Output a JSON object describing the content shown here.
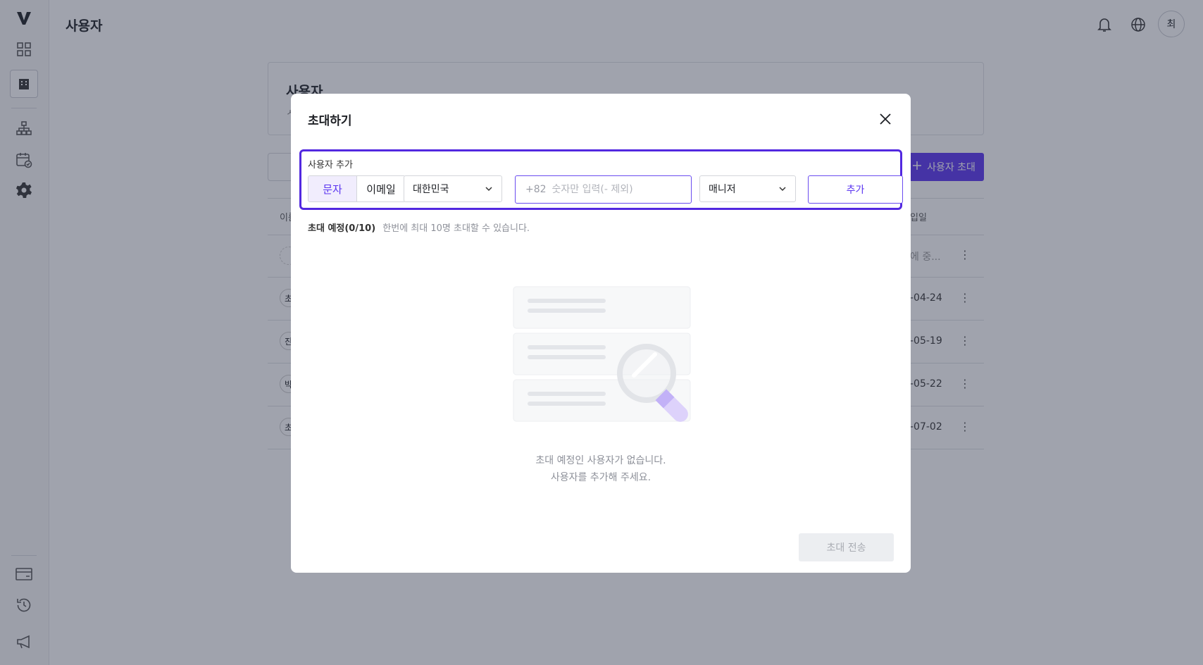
{
  "app": {
    "page_title": "사용자",
    "avatar_initial": "최"
  },
  "background": {
    "card_title": "사용자",
    "card_subtitle": "ㅅ",
    "invite_button_label": "사용자 초대",
    "table_header_first": "이름",
    "table_header_last": "입일",
    "rows": [
      {
        "name": "",
        "date": "에 중..."
      },
      {
        "name": "초",
        "date": "-04-24"
      },
      {
        "name": "진",
        "date": "-05-19"
      },
      {
        "name": "박",
        "date": "-05-22"
      },
      {
        "name": "초",
        "date": "-07-02"
      }
    ]
  },
  "modal": {
    "title": "초대하기",
    "add_section": {
      "label": "사용자 추가",
      "method_options": [
        "문자",
        "이메일"
      ],
      "selected_method": "문자",
      "country": "대한민국",
      "country_code": "+82",
      "phone_placeholder": "숫자만 입력(- 제외)",
      "phone_value": "",
      "role": "매니저",
      "add_button_label": "추가"
    },
    "scheduled": {
      "label": "초대 예정(0/10)",
      "hint": "한번에 최대 10명 초대할 수 있습니다."
    },
    "empty_state": {
      "line1": "초대 예정인 사용자가 없습니다.",
      "line2": "사용자를 추가해 주세요."
    },
    "send_button_label": "초대 전송"
  },
  "colors": {
    "accent": "#5a34f0",
    "accent_light": "#f1edfd",
    "overlay": "#2c334a",
    "disabled_bg": "#eceef1",
    "disabled_text": "#a8abb2"
  }
}
